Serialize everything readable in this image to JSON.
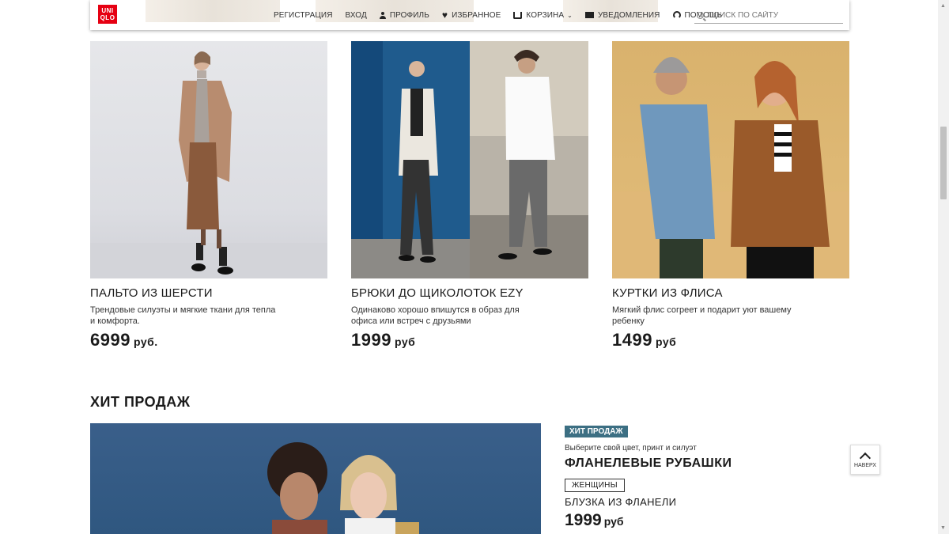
{
  "header": {
    "logo_line1": "UNI",
    "logo_line2": "QLO",
    "nav": {
      "register": "РЕГИСТРАЦИЯ",
      "login": "ВХОД",
      "profile": "ПРОФИЛЬ",
      "favorites": "ИЗБРАННОЕ",
      "cart": "КОРЗИНА",
      "notifications": "УВЕДОМЛЕНИЯ",
      "help": "ПОМОЩЬ"
    },
    "search": {
      "placeholder": "ПОИСК ПО САЙТУ"
    }
  },
  "products": [
    {
      "title": "ПАЛЬТО ИЗ ШЕРСТИ",
      "description": "Трендовые силуэты и мягкие ткани для тепла и комфорта.",
      "price": "6999",
      "currency": "руб."
    },
    {
      "title": "БРЮКИ ДО ЩИКОЛОТОК EZY",
      "description": "Одинаково хорошо впишутся в образ для офиса или встреч с друзьями",
      "price": "1999",
      "currency": "руб"
    },
    {
      "title": "КУРТКИ ИЗ ФЛИСА",
      "description": "Мягкий флис согреет и подарит уют вашему ребенку",
      "price": "1499",
      "currency": "руб"
    }
  ],
  "bestsellers": {
    "section_title": "ХИТ ПРОДАЖ",
    "badge": "ХИТ ПРОДАЖ",
    "subtitle": "Выберите свой цвет, принт и силуэт",
    "title": "ФЛАНЕЛЕВЫЕ РУБАШКИ",
    "category_badge": "ЖЕНЩИНЫ",
    "item_name": "БЛУЗКА ИЗ ФЛАНЕЛИ",
    "price": "1999",
    "currency": "руб"
  },
  "back_to_top": {
    "label": "НАВЕРХ"
  },
  "colors": {
    "brand_red": "#e60012",
    "badge_teal": "#3c6f83"
  }
}
